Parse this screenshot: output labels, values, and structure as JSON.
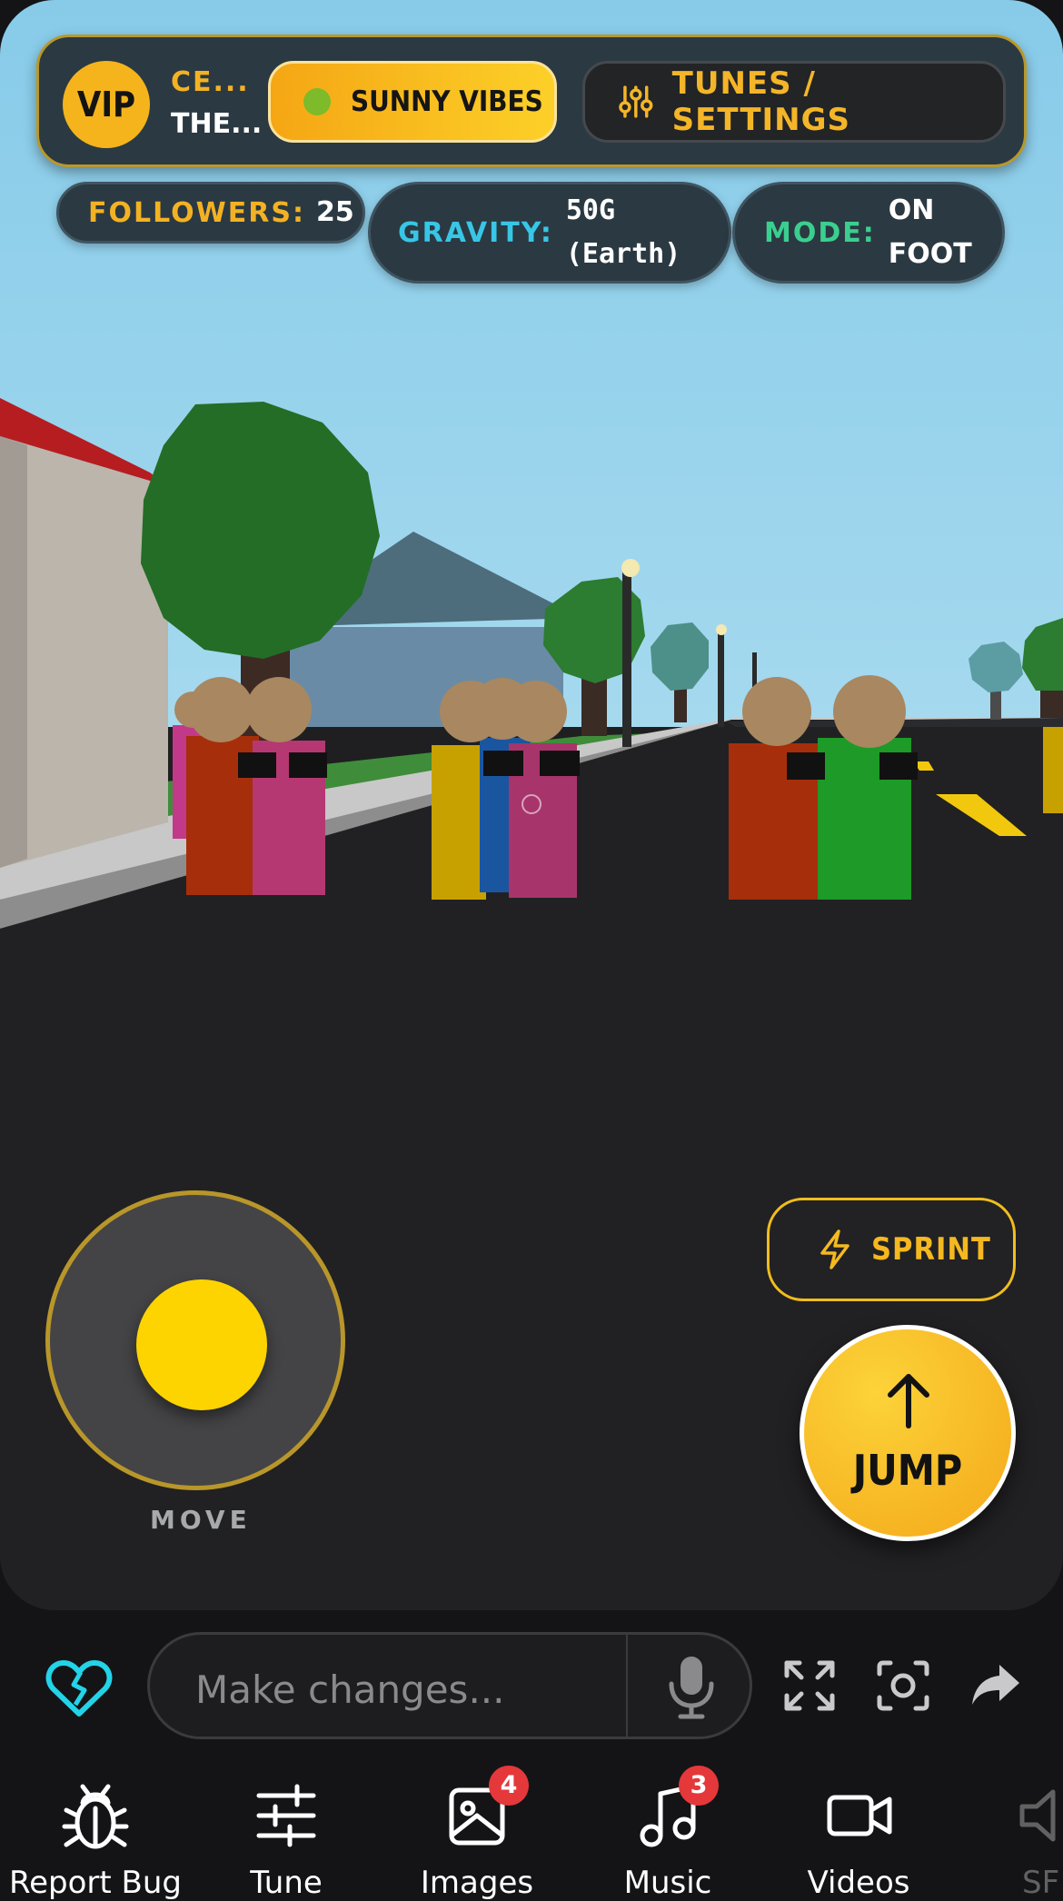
{
  "hud": {
    "vip_label": "VIP",
    "title_line1": "CE...",
    "title_line2": "THE...",
    "weather_label": "SUNNY VIBES",
    "settings_label": "TUNES / SETTINGS"
  },
  "stats": {
    "followers_key": "FOLLOWERS:",
    "followers_value": "25",
    "gravity_key": "GRAVITY:",
    "gravity_value_1": "50G",
    "gravity_value_2": "(Earth)",
    "mode_key": "MODE:",
    "mode_value_1": "ON",
    "mode_value_2": "FOOT"
  },
  "controls": {
    "move_label": "MOVE",
    "sprint_label": "SPRINT",
    "jump_label": "JUMP"
  },
  "chat": {
    "placeholder": "Make changes..."
  },
  "nav": {
    "items": [
      {
        "label": "Report Bug",
        "icon": "bug-icon"
      },
      {
        "label": "Tune",
        "icon": "sliders-icon"
      },
      {
        "label": "Images",
        "icon": "image-icon",
        "badge": "4"
      },
      {
        "label": "Music",
        "icon": "music-icon",
        "badge": "3"
      },
      {
        "label": "Videos",
        "icon": "video-icon"
      },
      {
        "label": "SF",
        "icon": "speaker-icon"
      }
    ]
  },
  "colors": {
    "accent": "#f5b41c",
    "hud_bg": "#2b3942",
    "sky": "#87ccea",
    "followers": "#f3b223",
    "gravity": "#38c6e6",
    "mode": "#3bcf8f",
    "heart": "#23d3e8",
    "badge": "#e5383b"
  }
}
